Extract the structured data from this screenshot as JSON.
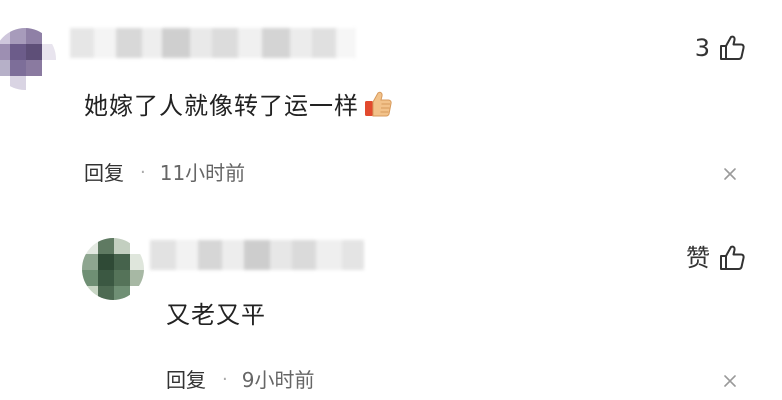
{
  "comments": [
    {
      "text": "她嫁了人就像转了运一样",
      "emoji": "thumbs-up-emoji",
      "like_count": "3",
      "reply_label": "回复",
      "separator": "·",
      "timestamp": "11小时前",
      "avatar_colors": [
        "#8a7aa0",
        "#5e4f78",
        "#b6b0c8",
        "#ffffff"
      ]
    },
    {
      "text": "又老又平",
      "like_count": "赞",
      "reply_label": "回复",
      "separator": "·",
      "timestamp": "9小时前",
      "avatar_colors": [
        "#2f4a36",
        "#6f8f74",
        "#c8d6c4",
        "#ffffff"
      ]
    }
  ],
  "icons": {
    "like": "thumbs-up-outline-icon",
    "close": "close-x-icon",
    "emoji": "thumbs-up-emoji"
  },
  "colors": {
    "text": "#222222",
    "meta": "#666666",
    "icon": "#333333",
    "emoji_skin": "#f2c28a",
    "emoji_cuff": "#e24a2e"
  }
}
